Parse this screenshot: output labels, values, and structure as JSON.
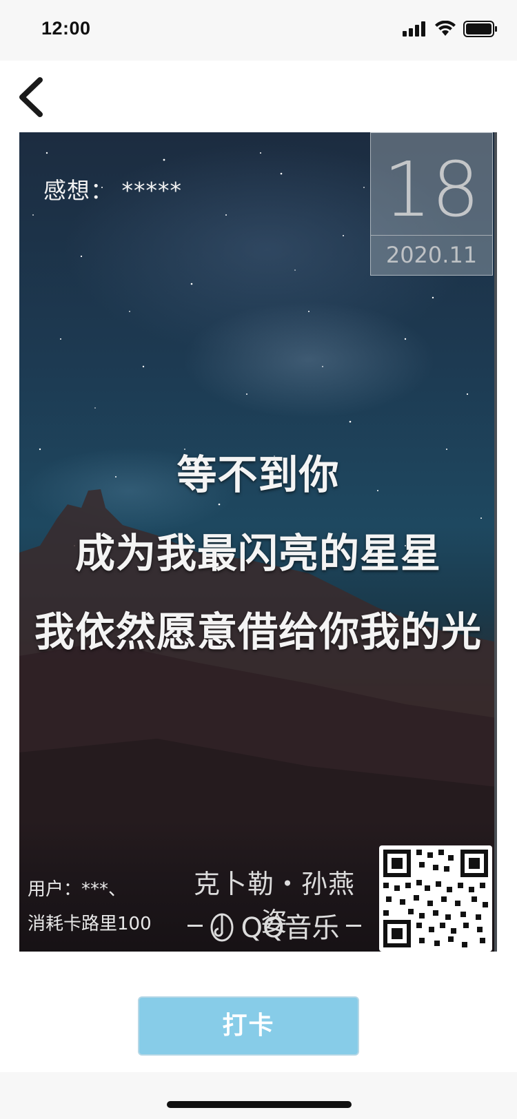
{
  "status_bar": {
    "time": "12:00",
    "icons": [
      "signal-icon",
      "wifi-icon",
      "battery-icon"
    ]
  },
  "nav": {
    "back_icon": "chevron-left-icon"
  },
  "poster": {
    "feeling": "感想： *****",
    "date_day": "18",
    "date_year_month": "2020.11",
    "lyrics": [
      "等不到你",
      "成为我最闪亮的星星",
      "我依然愿意借给你我的光"
    ],
    "user": "用户：***、",
    "calories": "消耗卡路里100",
    "singer": "克卜勒・孙燕姿",
    "brand": "QQ音乐",
    "qr_icon": "qr-code-icon"
  },
  "checkin_button": {
    "label": "打卡",
    "color": "#87cce8"
  }
}
